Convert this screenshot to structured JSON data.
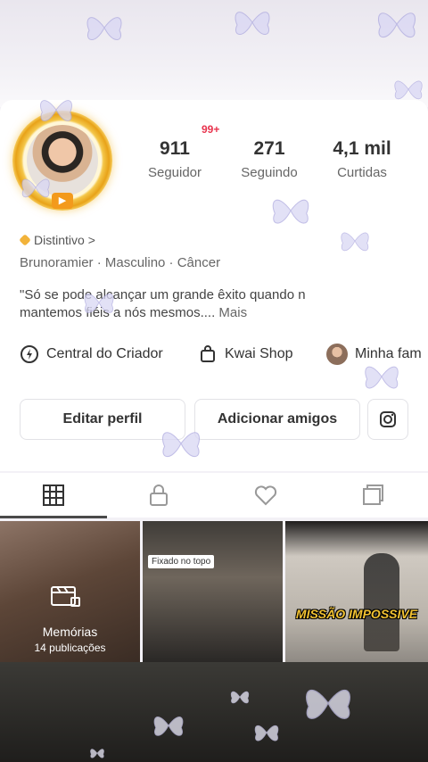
{
  "notification_badge": "99+",
  "stats": [
    {
      "value": "911",
      "label": "Seguidor"
    },
    {
      "value": "271",
      "label": "Seguindo"
    },
    {
      "value": "4,1 mil",
      "label": "Curtidas"
    }
  ],
  "badge": {
    "label": "Distintivo",
    "chevron": ">"
  },
  "profile": {
    "tags": "Brunoramier · Masculino · Câncer",
    "bio_line1": "\"Só se pode alcançar um grande êxito quando n",
    "bio_line2": "mantemos fiéis a nós mesmos....",
    "bio_more": "Mais"
  },
  "quick_links": {
    "creator_center": "Central do Criador",
    "kwai_shop": "Kwai Shop",
    "family": "Minha fam"
  },
  "actions": {
    "edit_profile": "Editar perfil",
    "add_friends": "Adicionar amigos"
  },
  "grid": {
    "memories_title": "Memórias",
    "memories_count": "14 publicações",
    "pinned_label": "Fixado no topo",
    "video_title": "MISSÃO IMPOSSIVE"
  },
  "icons": [
    "play-icon",
    "creator-center-icon",
    "shopping-bag-icon",
    "family-avatar-icon",
    "instagram-icon",
    "grid-icon",
    "lock-icon",
    "heart-icon",
    "collection-icon",
    "memories-icon",
    "butterfly-icon"
  ],
  "colors": {
    "accent_gold": "#f2b33a",
    "notification_red": "#e8344e",
    "card_bg": "#ffffff"
  }
}
